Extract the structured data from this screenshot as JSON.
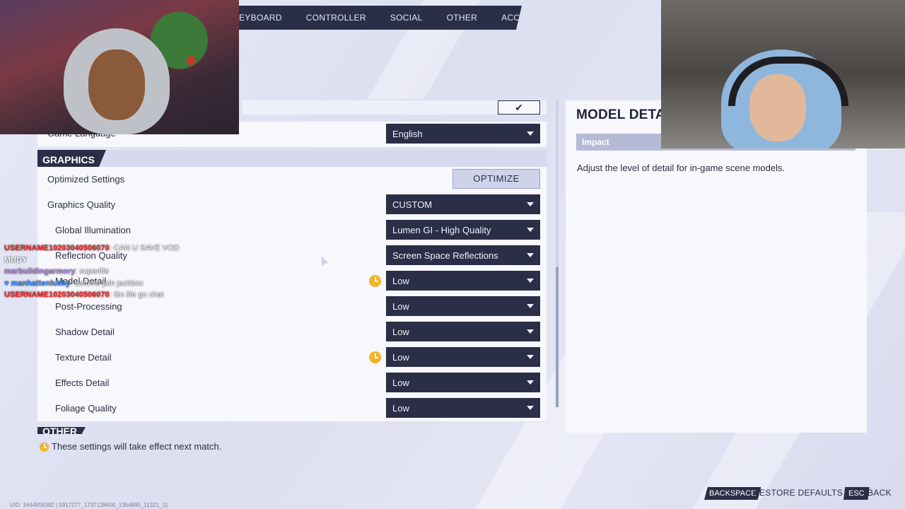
{
  "nav": {
    "tabs": [
      "EYBOARD",
      "CONTROLLER",
      "SOCIAL",
      "OTHER",
      "ACCESSIBILITY"
    ]
  },
  "settings": {
    "apply_icon": "checkmark-icon",
    "game_language": {
      "label": "Game Language",
      "value": "English"
    },
    "graphics_section": "GRAPHICS",
    "optimized": {
      "label": "Optimized Settings",
      "button": "OPTIMIZE"
    },
    "graphics_quality": {
      "label": "Graphics Quality",
      "value": "CUSTOM"
    },
    "rows": [
      {
        "label": "Global Illumination",
        "value": "Lumen GI - High Quality"
      },
      {
        "label": "Reflection Quality",
        "value": "Screen Space Reflections"
      },
      {
        "label": "Model Detail",
        "value": "Low"
      },
      {
        "label": "Post-Processing",
        "value": "Low"
      },
      {
        "label": "Shadow Detail",
        "value": "Low"
      },
      {
        "label": "Texture Detail",
        "value": "Low"
      },
      {
        "label": "Effects Detail",
        "value": "Low"
      },
      {
        "label": "Foliage Quality",
        "value": "Low"
      }
    ],
    "other_section": "OTHER"
  },
  "detail_panel": {
    "title": "MODEL DETAIL",
    "impact_label": "Impact",
    "description": "Adjust the level of detail for in-game scene models."
  },
  "footer": {
    "note": "These settings will take effect next match.",
    "backspace_key": "BACKSPACE",
    "restore_label": "RESTORE DEFAULTS",
    "esc_key": "ESC",
    "back_label": "BACK",
    "build_id": "UID: 1644858382 | 5917277_1737128400_1354895_11321_11"
  },
  "chat": [
    {
      "user": "USERNAME10203040506070",
      "msg": ": CAN U SAVE VOD",
      "color": "#ff2a2a"
    },
    {
      "user": "MUDY",
      "msg": "",
      "color": "#ffffff"
    },
    {
      "user": "marbuildingarmory",
      "msg": ": superlife",
      "color": "#b08adf"
    },
    {
      "user": "♥ manhattenlucky",
      "msg": ": Lemme join jackbox",
      "color": "#3a8dff"
    },
    {
      "user": "USERNAME10203040506070",
      "msg": ": Gn life gn chat",
      "color": "#ff2a2a"
    }
  ]
}
